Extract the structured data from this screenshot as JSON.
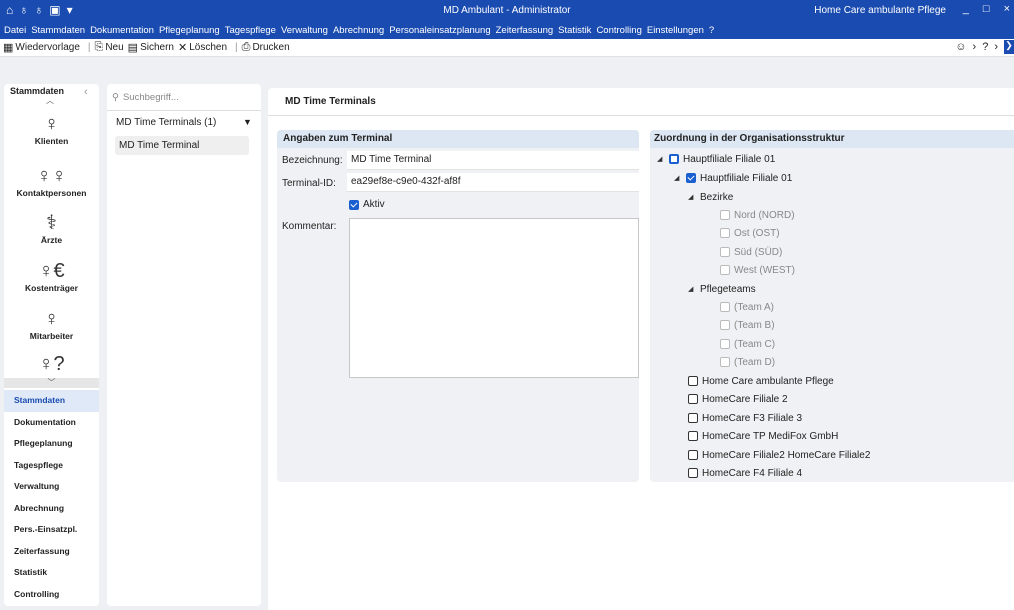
{
  "titlebar": {
    "title": "MD Ambulant - Administrator",
    "company": "Home Care ambulante Pflege",
    "quick_icons": [
      "home-icon",
      "user-icon",
      "user-euro-icon",
      "save-file-icon",
      "dropdown-icon"
    ],
    "minimize": "_",
    "maximize": "□",
    "close": "×"
  },
  "menu": [
    "Datei",
    "Stammdaten",
    "Dokumentation",
    "Pflegeplanung",
    "Tagespflege",
    "Verwaltung",
    "Abrechnung",
    "Personaleinsatzplanung",
    "Zeiterfassung",
    "Statistik",
    "Controlling",
    "Einstellungen",
    "?"
  ],
  "toolbar": {
    "wiedervorlage": "Wiedervorlage",
    "neu": "Neu",
    "sichern": "Sichern",
    "loeschen": "Löschen",
    "drucken": "Drucken"
  },
  "leftnav": {
    "header": "Stammdaten",
    "modules": [
      {
        "label": "Klienten",
        "icon": "person-icon"
      },
      {
        "label": "Kontaktpersonen",
        "icon": "people-icon"
      },
      {
        "label": "Ärzte",
        "icon": "doctor-icon"
      },
      {
        "label": "Kostenträger",
        "icon": "person-euro-icon"
      },
      {
        "label": "Mitarbeiter",
        "icon": "employee-icon"
      },
      {
        "label": "",
        "icon": "person-question-icon"
      }
    ],
    "sections": [
      "Stammdaten",
      "Dokumentation",
      "Pflegeplanung",
      "Tagespflege",
      "Verwaltung",
      "Abrechnung",
      "Pers.-Einsatzpl.",
      "Zeiterfassung",
      "Statistik",
      "Controlling"
    ],
    "active_section": "Stammdaten"
  },
  "list": {
    "search_placeholder": "Suchbegriff...",
    "group": "MD Time Terminals (1)",
    "items": [
      "MD Time Terminal"
    ]
  },
  "main": {
    "title": "MD Time Terminals",
    "details": {
      "header": "Angaben zum Terminal",
      "bezeichnung_label": "Bezeichnung:",
      "bezeichnung_value": "MD Time Terminal",
      "terminal_id_label": "Terminal-ID:",
      "terminal_id_value": "ea29ef8e-c9e0-432f-af8f",
      "aktiv_label": "Aktiv",
      "aktiv_checked": true,
      "kommentar_label": "Kommentar:",
      "kommentar_value": ""
    },
    "org": {
      "header": "Zuordnung in der Organisationsstruktur",
      "tree": [
        {
          "label": "Hauptfiliale Filiale 01",
          "state": "focus",
          "caret": true
        },
        {
          "label": "Hauptfiliale Filiale 01",
          "state": "checked",
          "caret": true
        },
        {
          "label": "Bezirke",
          "state": "none",
          "caret": true
        },
        {
          "label": "Nord (NORD)",
          "state": "disabled"
        },
        {
          "label": "Ost (OST)",
          "state": "disabled"
        },
        {
          "label": "Süd (SÜD)",
          "state": "disabled"
        },
        {
          "label": "West (WEST)",
          "state": "disabled"
        },
        {
          "label": "Pflegeteams",
          "state": "none",
          "caret": true
        },
        {
          "label": "(Team A)",
          "state": "disabled"
        },
        {
          "label": "(Team B)",
          "state": "disabled"
        },
        {
          "label": "(Team C)",
          "state": "disabled"
        },
        {
          "label": "(Team D)",
          "state": "disabled"
        },
        {
          "label": "Home Care ambulante Pflege",
          "state": "unchecked"
        },
        {
          "label": "HomeCare Filiale 2",
          "state": "unchecked"
        },
        {
          "label": "HomeCare F3 Filiale 3",
          "state": "unchecked"
        },
        {
          "label": "HomeCare TP MediFox GmbH",
          "state": "unchecked"
        },
        {
          "label": "HomeCare Filiale2 HomeCare Filiale2",
          "state": "unchecked"
        },
        {
          "label": "HomeCare F4 Filiale 4",
          "state": "unchecked"
        }
      ]
    }
  }
}
